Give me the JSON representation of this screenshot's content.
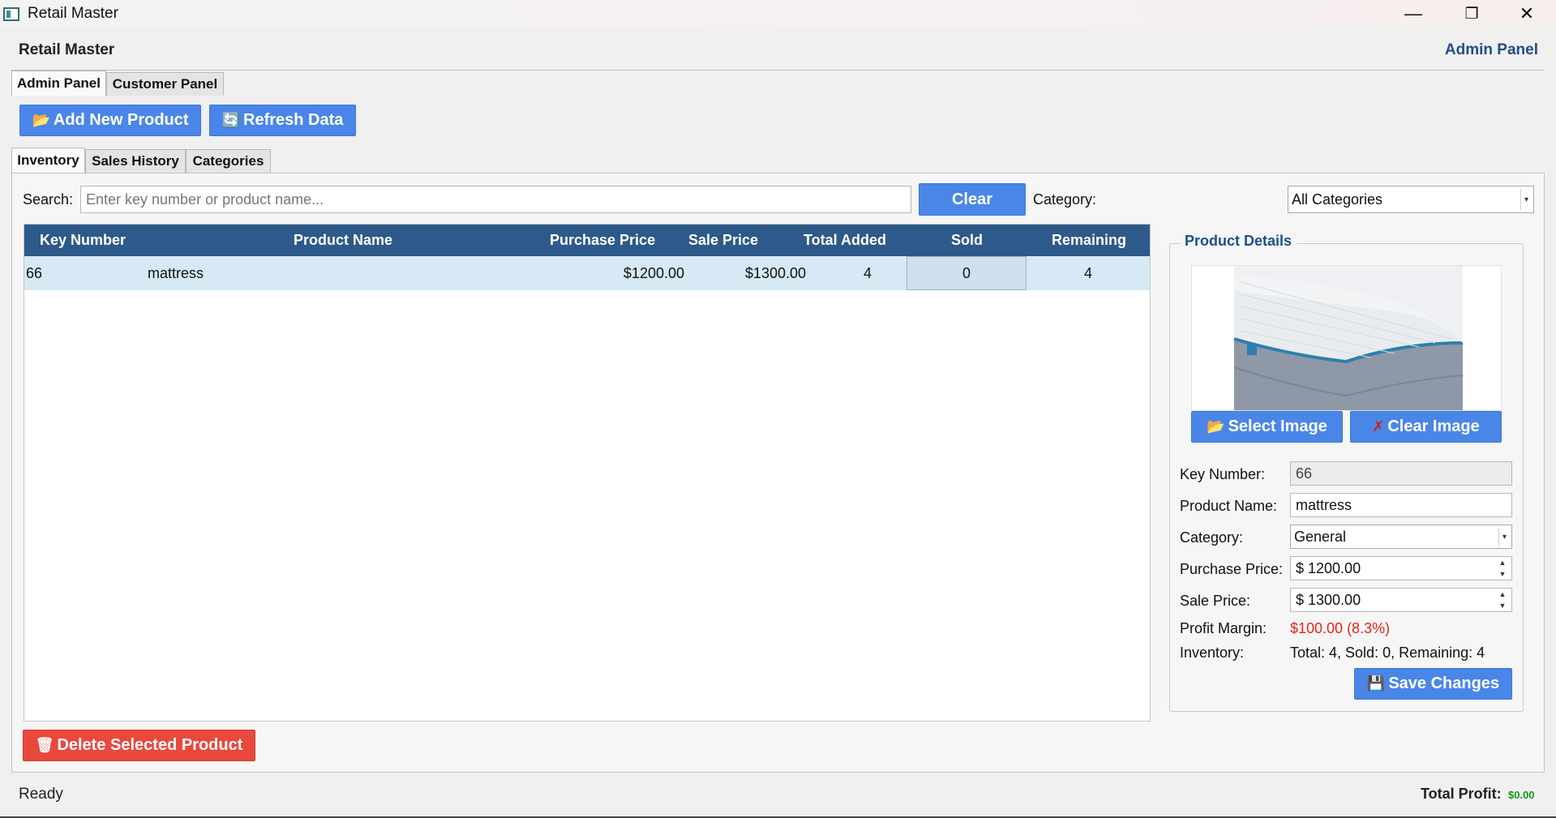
{
  "window": {
    "title": "Retail Master",
    "controls": {
      "minimize": "—",
      "maximize": "❐",
      "close": "✕"
    }
  },
  "header": {
    "app_name": "Retail Master",
    "panel_label": "Admin Panel"
  },
  "main_tabs": [
    {
      "label": "Admin Panel",
      "active": true
    },
    {
      "label": "Customer Panel",
      "active": false
    }
  ],
  "toolbar": {
    "add_label": "Add New Product",
    "refresh_label": "Refresh Data",
    "add_icon": "folder-add-icon",
    "refresh_icon": "refresh-icon"
  },
  "sub_tabs": [
    {
      "label": "Inventory",
      "active": true
    },
    {
      "label": "Sales History",
      "active": false
    },
    {
      "label": "Categories",
      "active": false
    }
  ],
  "search": {
    "label": "Search:",
    "placeholder": "Enter key number or product name...",
    "value": "",
    "clear_label": "Clear",
    "category_label": "Category:",
    "category_value": "All Categories"
  },
  "table": {
    "columns": [
      "Key Number",
      "Product Name",
      "Purchase Price",
      "Sale Price",
      "Total Added",
      "Sold",
      "Remaining"
    ],
    "rows": [
      {
        "key": "66",
        "name": "mattress",
        "purchase": "$1200.00",
        "sale": "$1300.00",
        "total": "4",
        "sold": "0",
        "remaining": "4"
      }
    ]
  },
  "delete_label": "Delete Selected Product",
  "details": {
    "title": "Product Details",
    "select_image_label": "Select Image",
    "clear_image_label": "Clear Image",
    "key_label": "Key Number:",
    "key_value": "66",
    "name_label": "Product Name:",
    "name_value": "mattress",
    "category_label": "Category:",
    "category_value": "General",
    "purchase_label": "Purchase Price:",
    "purchase_value": "$ 1200.00",
    "sale_label": "Sale Price:",
    "sale_value": "$ 1300.00",
    "margin_label": "Profit Margin:",
    "margin_value": "$100.00 (8.3%)",
    "inventory_label": "Inventory:",
    "inventory_value": "Total: 4, Sold: 0, Remaining: 4",
    "save_label": "Save Changes"
  },
  "status_bar": {
    "status": "Ready",
    "profit_label": "Total Profit:",
    "profit_value": "$0.00"
  },
  "colors": {
    "accent_blue": "#4a86e8",
    "header_blue": "#2d5a8a",
    "danger_red": "#e9483d",
    "margin_red": "#e8231a",
    "profit_green": "#119911"
  }
}
